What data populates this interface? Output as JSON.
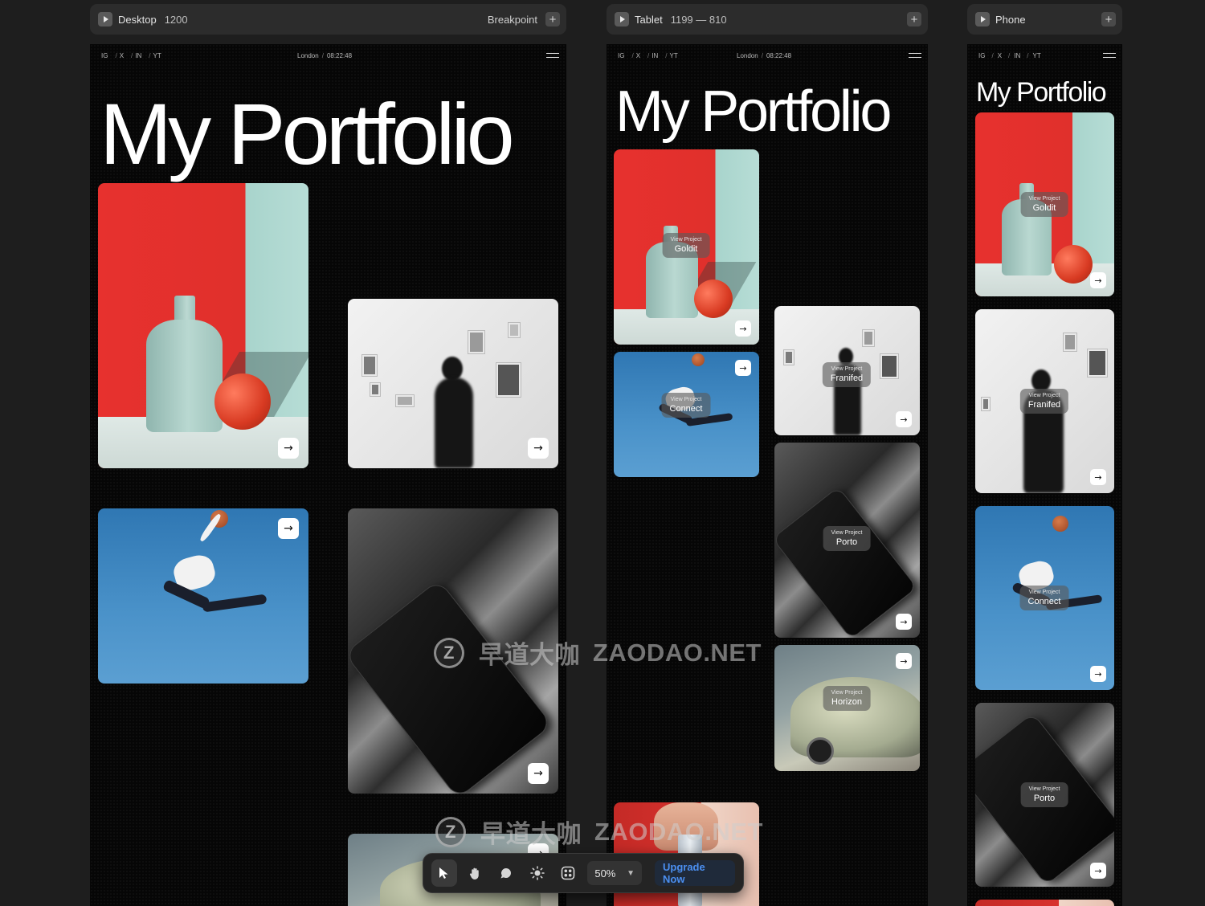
{
  "breakpoints": [
    {
      "name": "Desktop",
      "size": "1200",
      "label": "Breakpoint"
    },
    {
      "name": "Tablet",
      "size": "1199 — 810",
      "label": ""
    },
    {
      "name": "Phone",
      "size": "",
      "label": ""
    }
  ],
  "site": {
    "socials": [
      "IG",
      "X",
      "IN",
      "YT"
    ],
    "separator": "/",
    "city": "London",
    "time": "08:22:48",
    "title": "My Portfolio",
    "view_project": "View Project"
  },
  "projects": [
    "Goldit",
    "Franifed",
    "Connect",
    "Porto",
    "Horizon"
  ],
  "icons": {
    "play": "play-icon",
    "plus": "plus-icon",
    "menu": "menu-icon",
    "arrow": "arrow-right-icon"
  },
  "arrow_glyph": "→",
  "watermark": {
    "logo": "Z",
    "cn": "早道大咖",
    "en": "ZAODAO.NET"
  },
  "toolbar": {
    "tools": [
      "select",
      "hand",
      "comment",
      "theme",
      "components"
    ],
    "zoom": "50%",
    "upgrade": "Upgrade Now"
  }
}
